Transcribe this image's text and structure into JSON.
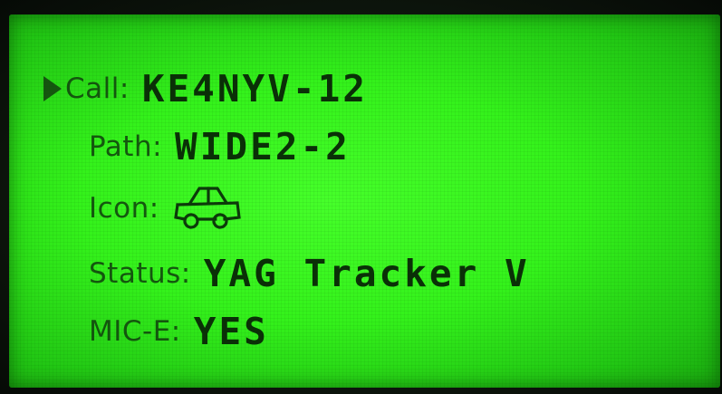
{
  "display": {
    "rows": [
      {
        "label": "Call:",
        "value": "KE4NYV-12",
        "selected": true
      },
      {
        "label": "Path:",
        "value": "WIDE2-2"
      },
      {
        "label": "Icon:",
        "icon": "car-icon"
      },
      {
        "label": "Status:",
        "value": "YAG Tracker V"
      },
      {
        "label": "MIC-E:",
        "value": "YES"
      }
    ]
  },
  "colors": {
    "lcd_background": "#34f21b",
    "lcd_text": "#0a3007"
  }
}
